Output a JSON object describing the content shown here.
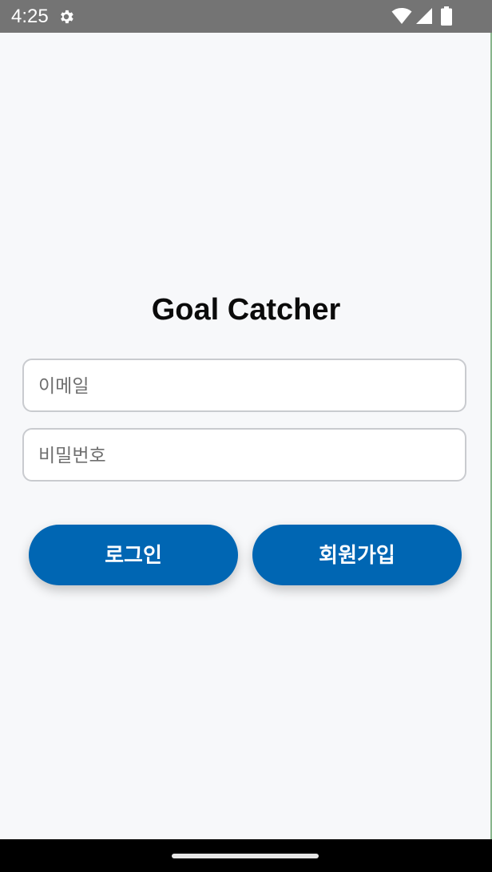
{
  "status_bar": {
    "time": "4:25",
    "icons": [
      "gear-icon",
      "wifi-icon",
      "signal-icon",
      "battery-icon"
    ]
  },
  "app": {
    "title": "Goal Catcher"
  },
  "form": {
    "email_placeholder": "이메일",
    "email_value": "",
    "password_placeholder": "비밀번호",
    "password_value": ""
  },
  "buttons": {
    "login_label": "로그인",
    "signup_label": "회원가입"
  },
  "colors": {
    "primary": "#0066b3",
    "background": "#f7f8fa",
    "status_bar": "#747474",
    "nav_bar": "#000000",
    "field_border": "#c9cbcf"
  }
}
